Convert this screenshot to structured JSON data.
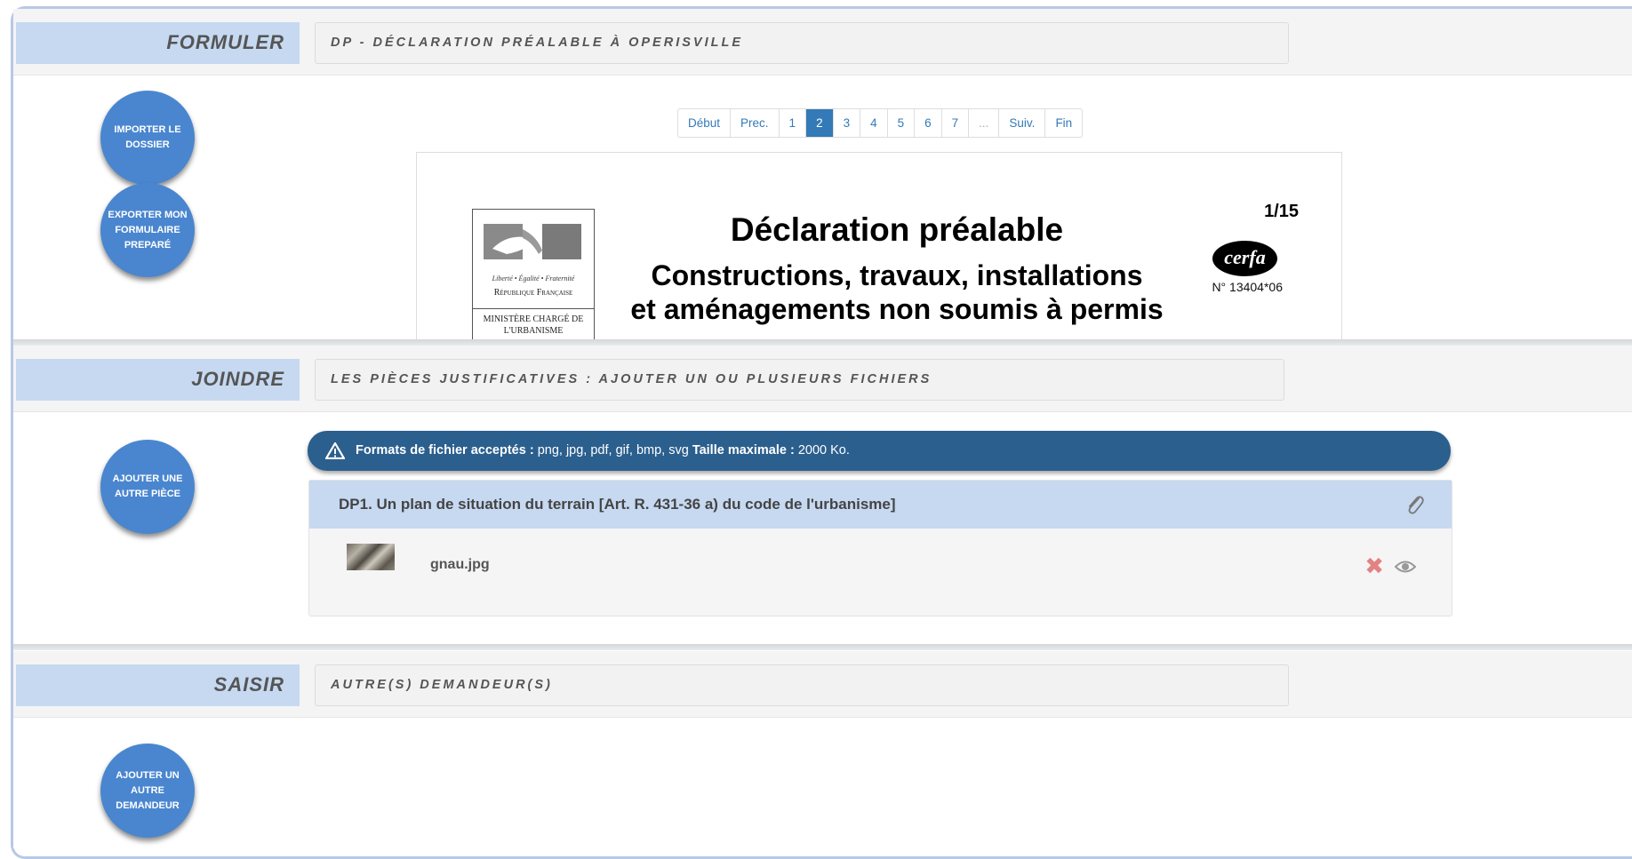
{
  "sections": {
    "formuler": {
      "label": "FORMULER",
      "title": "DP - DÉCLARATION PRÉALABLE À OPERISVILLE",
      "buttons": {
        "import": "IMPORTER LE DOSSIER",
        "export": "EXPORTER MON FORMULAIRE PREPARÉ"
      }
    },
    "joindre": {
      "label": "JOINDRE",
      "title": "LES PIÈCES JUSTIFICATIVES : AJOUTER UN OU PLUSIEURS FICHIERS",
      "buttons": {
        "add_piece": "AJOUTER UNE AUTRE PIÈCE"
      }
    },
    "saisir": {
      "label": "SAISIR",
      "title": "AUTRE(S) DEMANDEUR(S)",
      "buttons": {
        "add_applicant": "AJOUTER UN AUTRE DEMANDEUR"
      }
    }
  },
  "pagination": {
    "first": "Début",
    "prev": "Prec.",
    "pages": [
      "1",
      "2",
      "3",
      "4",
      "5",
      "6",
      "7"
    ],
    "current": "2",
    "ellipsis": "...",
    "next": "Suiv.",
    "last": "Fin"
  },
  "document": {
    "title": "Déclaration préalable",
    "subtitle_1": "Constructions, travaux, installations",
    "subtitle_2": "et aménagements non soumis à permis",
    "page_counter": "1/15",
    "cerfa_logo": "cerfa",
    "cerfa_number": "N° 13404*06",
    "marianne": {
      "motto": "Liberté • Égalité • Fraternité",
      "republic": "République Française",
      "ministry": "MINISTÈRE CHARGÉ DE L'URBANISME"
    }
  },
  "upload_info": {
    "icon": "warning-triangle-icon",
    "formats_label": "Formats de fichier acceptés :",
    "formats_value": " png, jpg, pdf, gif, bmp, svg ",
    "max_label": "Taille maximale :",
    "max_value": " 2000 Ko."
  },
  "pieces": [
    {
      "title": "DP1. Un plan de situation du terrain [Art. R. 431-36 a) du code de l'urbanisme]",
      "files": [
        {
          "name": "gnau.jpg"
        }
      ]
    }
  ],
  "colors": {
    "section_label_bg": "#c6d9f1",
    "button_blue": "#4a86cf",
    "info_bar": "#2b5f8e",
    "pager_active": "#337ab7",
    "delete": "#e38282"
  }
}
